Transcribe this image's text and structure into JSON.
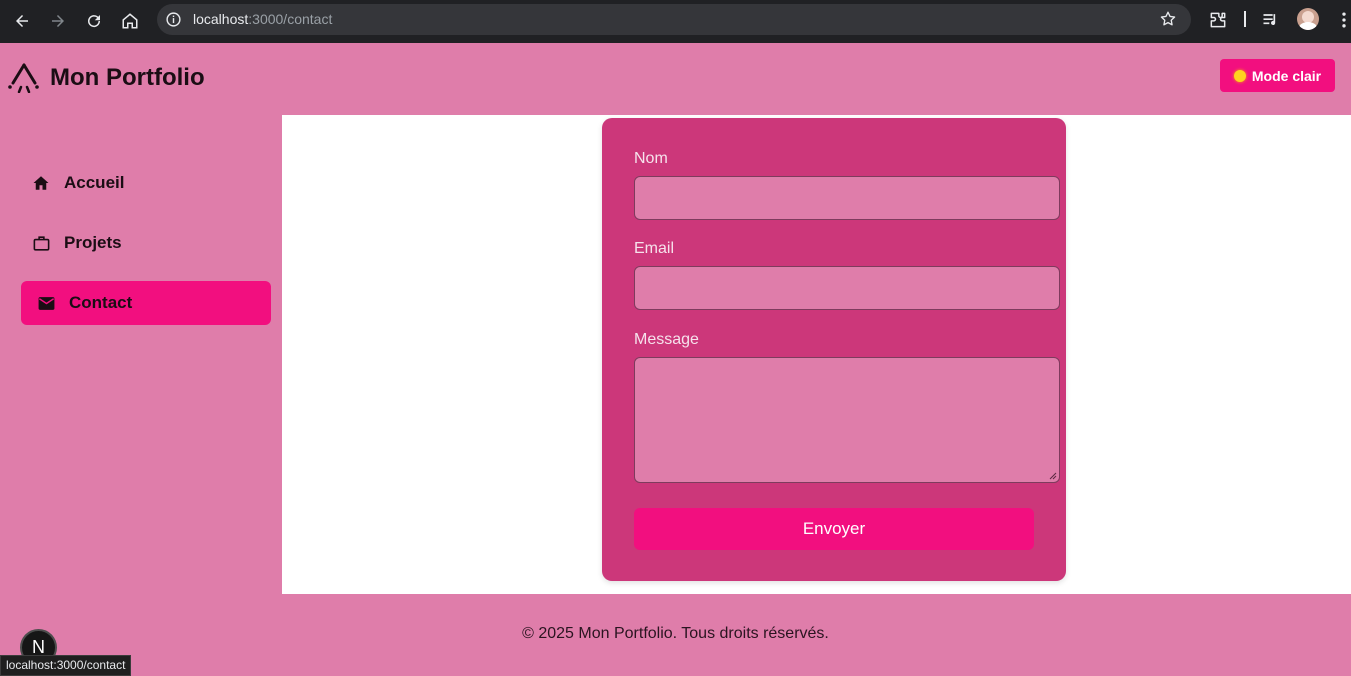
{
  "browser": {
    "url_host": "localhost",
    "url_path": ":3000/contact",
    "status_url": "localhost:3000/contact"
  },
  "header": {
    "title": "Mon Portfolio",
    "mode_button_label": "Mode clair"
  },
  "sidebar": {
    "items": [
      {
        "label": "Accueil",
        "icon": "home-icon",
        "active": false
      },
      {
        "label": "Projets",
        "icon": "briefcase-icon",
        "active": false
      },
      {
        "label": "Contact",
        "icon": "mail-icon",
        "active": true
      }
    ]
  },
  "form": {
    "name_label": "Nom",
    "name_value": "",
    "email_label": "Email",
    "email_value": "",
    "message_label": "Message",
    "message_value": "",
    "submit_label": "Envoyer"
  },
  "footer": {
    "text": "© 2025 Mon Portfolio. Tous droits réservés."
  },
  "dev_badge": {
    "label": "N"
  },
  "colors": {
    "background": "#df7daa",
    "accent": "#f20f7f",
    "card": "#cc377a",
    "chrome": "#202124"
  }
}
